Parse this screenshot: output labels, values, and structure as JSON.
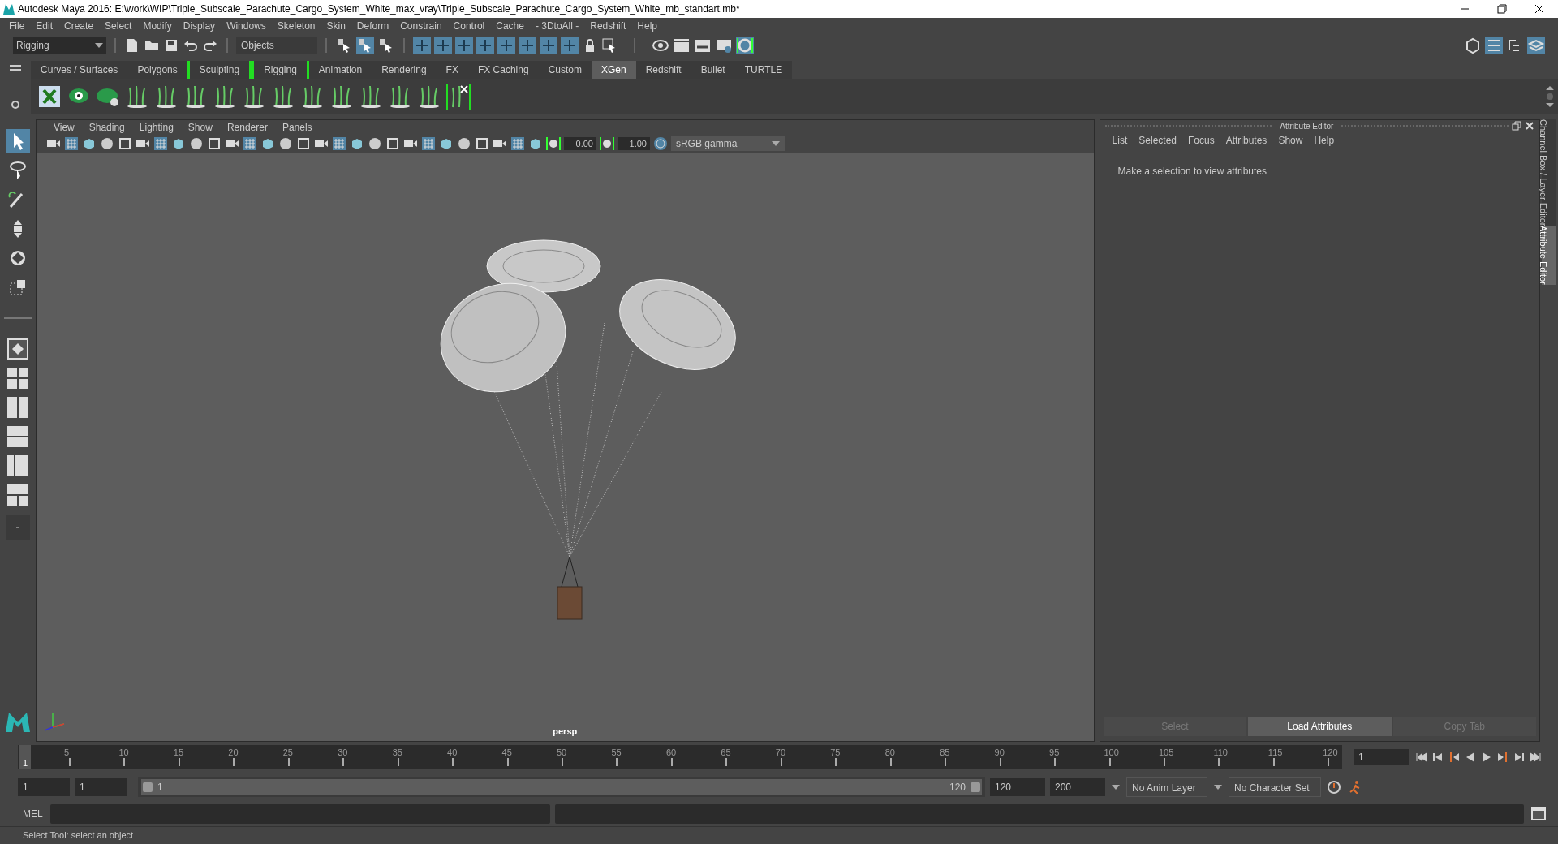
{
  "window": {
    "title": "Autodesk Maya 2016: E:\\work\\WIP\\Triple_Subscale_Parachute_Cargo_System_White_max_vray\\Triple_Subscale_Parachute_Cargo_System_White_mb_standart.mb*"
  },
  "menu": [
    "File",
    "Edit",
    "Create",
    "Select",
    "Modify",
    "Display",
    "Windows",
    "Skeleton",
    "Skin",
    "Deform",
    "Constrain",
    "Control",
    "Cache",
    "- 3DtoAll -",
    "Redshift",
    "Help"
  ],
  "toolbar": {
    "mode": "Rigging",
    "selection_mask": "Objects"
  },
  "shelf_tabs": [
    {
      "label": "Curves / Surfaces",
      "selected": false,
      "bracketed": false
    },
    {
      "label": "Polygons",
      "selected": false,
      "bracketed": false
    },
    {
      "label": "Sculpting",
      "selected": false,
      "bracketed": true
    },
    {
      "label": "Rigging",
      "selected": false,
      "bracketed": true
    },
    {
      "label": "Animation",
      "selected": false,
      "bracketed": false
    },
    {
      "label": "Rendering",
      "selected": false,
      "bracketed": false
    },
    {
      "label": "FX",
      "selected": false,
      "bracketed": false
    },
    {
      "label": "FX Caching",
      "selected": false,
      "bracketed": false
    },
    {
      "label": "Custom",
      "selected": false,
      "bracketed": false
    },
    {
      "label": "XGen",
      "selected": true,
      "bracketed": false
    },
    {
      "label": "Redshift",
      "selected": false,
      "bracketed": false
    },
    {
      "label": "Bullet",
      "selected": false,
      "bracketed": false
    },
    {
      "label": "TURTLE",
      "selected": false,
      "bracketed": false
    }
  ],
  "viewport": {
    "menu": [
      "View",
      "Shading",
      "Lighting",
      "Show",
      "Renderer",
      "Panels"
    ],
    "exposure": "0.00",
    "gamma": "1.00",
    "color_space": "sRGB gamma",
    "camera": "persp"
  },
  "attribute_editor": {
    "title": "Attribute Editor",
    "menu": [
      "List",
      "Selected",
      "Focus",
      "Attributes",
      "Show",
      "Help"
    ],
    "message": "Make a selection to view attributes",
    "buttons": [
      {
        "label": "Select",
        "disabled": true
      },
      {
        "label": "Load Attributes",
        "disabled": false
      },
      {
        "label": "Copy Tab",
        "disabled": true
      }
    ]
  },
  "side_tabs": [
    {
      "label": "Channel Box / Layer Editor",
      "selected": false
    },
    {
      "label": "Attribute Editor",
      "selected": true
    }
  ],
  "timeline": {
    "ticks": [
      "5",
      "10",
      "15",
      "20",
      "25",
      "30",
      "35",
      "40",
      "45",
      "50",
      "55",
      "60",
      "65",
      "70",
      "75",
      "80",
      "85",
      "90",
      "95",
      "100",
      "105",
      "110",
      "115",
      "120"
    ],
    "current_frame": "1",
    "frame_field": "1"
  },
  "range": {
    "start": "1",
    "playback_start": "1",
    "slider_start": "1",
    "slider_end": "120",
    "playback_end": "120",
    "end": "200",
    "anim_layer": "No Anim Layer",
    "character_set": "No Character Set"
  },
  "command_line": {
    "label": "MEL"
  },
  "status": "Select Tool: select an object"
}
